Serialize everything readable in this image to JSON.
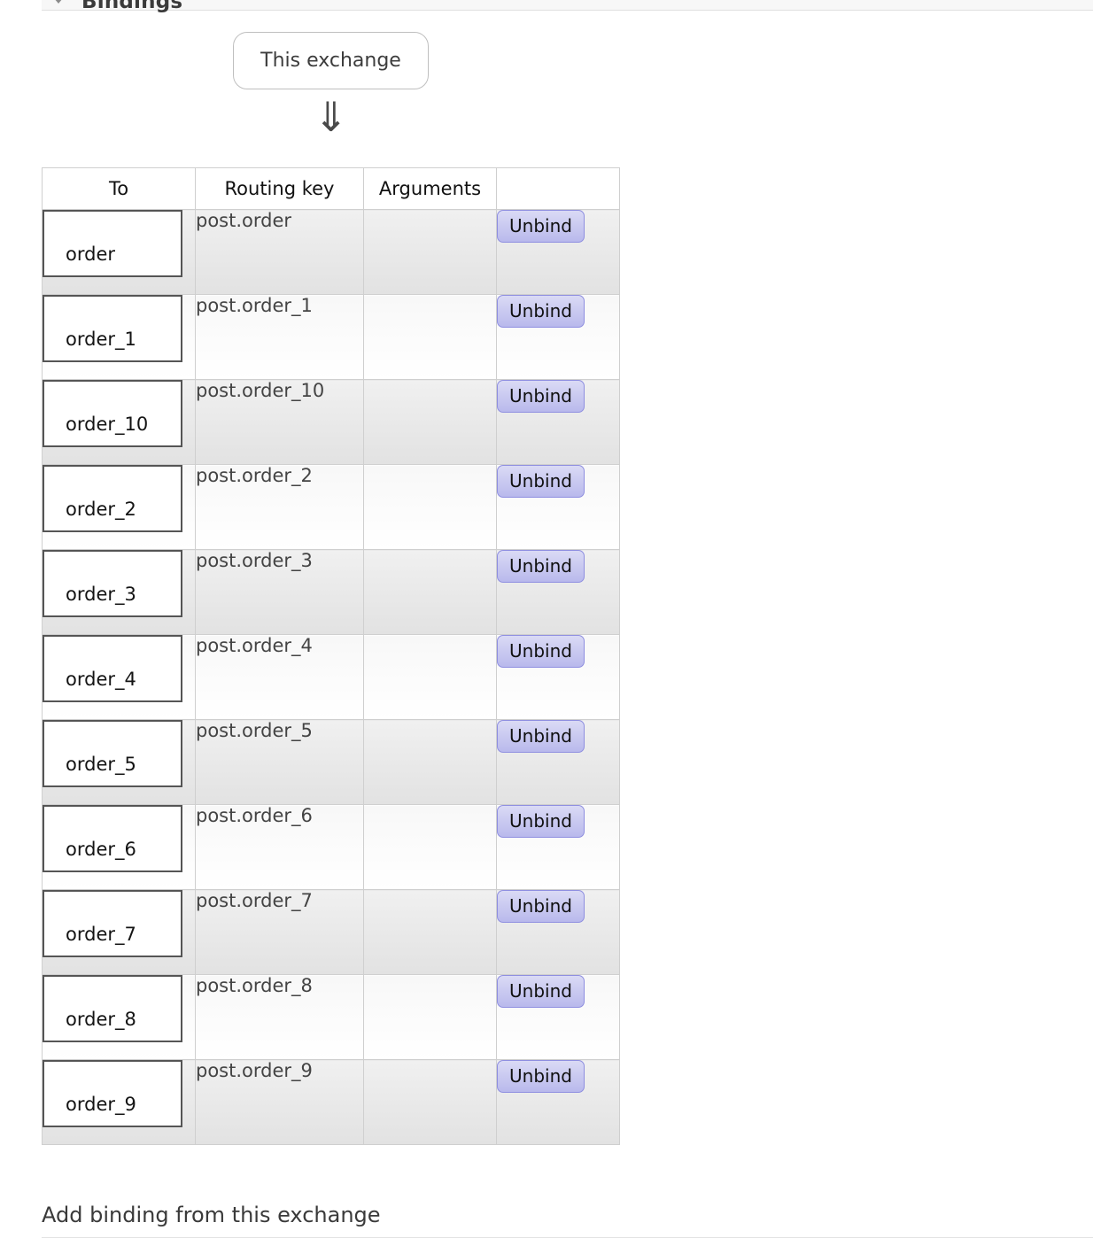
{
  "section": {
    "title": "Bindings",
    "caret_icon": "caret-down-icon"
  },
  "diagram": {
    "source_node_label": "This exchange",
    "arrow_icon": "double-down-arrow-icon",
    "arrow_glyph": "⇓"
  },
  "table": {
    "columns": [
      "To",
      "Routing key",
      "Arguments",
      ""
    ],
    "rows": [
      {
        "to": "order",
        "routing_key": "post.order",
        "arguments": "",
        "action": "Unbind"
      },
      {
        "to": "order_1",
        "routing_key": "post.order_1",
        "arguments": "",
        "action": "Unbind"
      },
      {
        "to": "order_10",
        "routing_key": "post.order_10",
        "arguments": "",
        "action": "Unbind"
      },
      {
        "to": "order_2",
        "routing_key": "post.order_2",
        "arguments": "",
        "action": "Unbind"
      },
      {
        "to": "order_3",
        "routing_key": "post.order_3",
        "arguments": "",
        "action": "Unbind"
      },
      {
        "to": "order_4",
        "routing_key": "post.order_4",
        "arguments": "",
        "action": "Unbind"
      },
      {
        "to": "order_5",
        "routing_key": "post.order_5",
        "arguments": "",
        "action": "Unbind"
      },
      {
        "to": "order_6",
        "routing_key": "post.order_6",
        "arguments": "",
        "action": "Unbind"
      },
      {
        "to": "order_7",
        "routing_key": "post.order_7",
        "arguments": "",
        "action": "Unbind"
      },
      {
        "to": "order_8",
        "routing_key": "post.order_8",
        "arguments": "",
        "action": "Unbind"
      },
      {
        "to": "order_9",
        "routing_key": "post.order_9",
        "arguments": "",
        "action": "Unbind"
      }
    ]
  },
  "add_binding": {
    "label": "Add binding from this exchange"
  },
  "colors": {
    "unbind_button_face": "#c6c6f0",
    "unbind_button_border": "#8e8ee0",
    "row_odd": "#e6e6e6",
    "row_even": "#fcfcfc",
    "table_border": "#cfcfcf",
    "queue_box_border": "#555555",
    "text_primary": "#141414",
    "text_secondary": "#444444"
  }
}
